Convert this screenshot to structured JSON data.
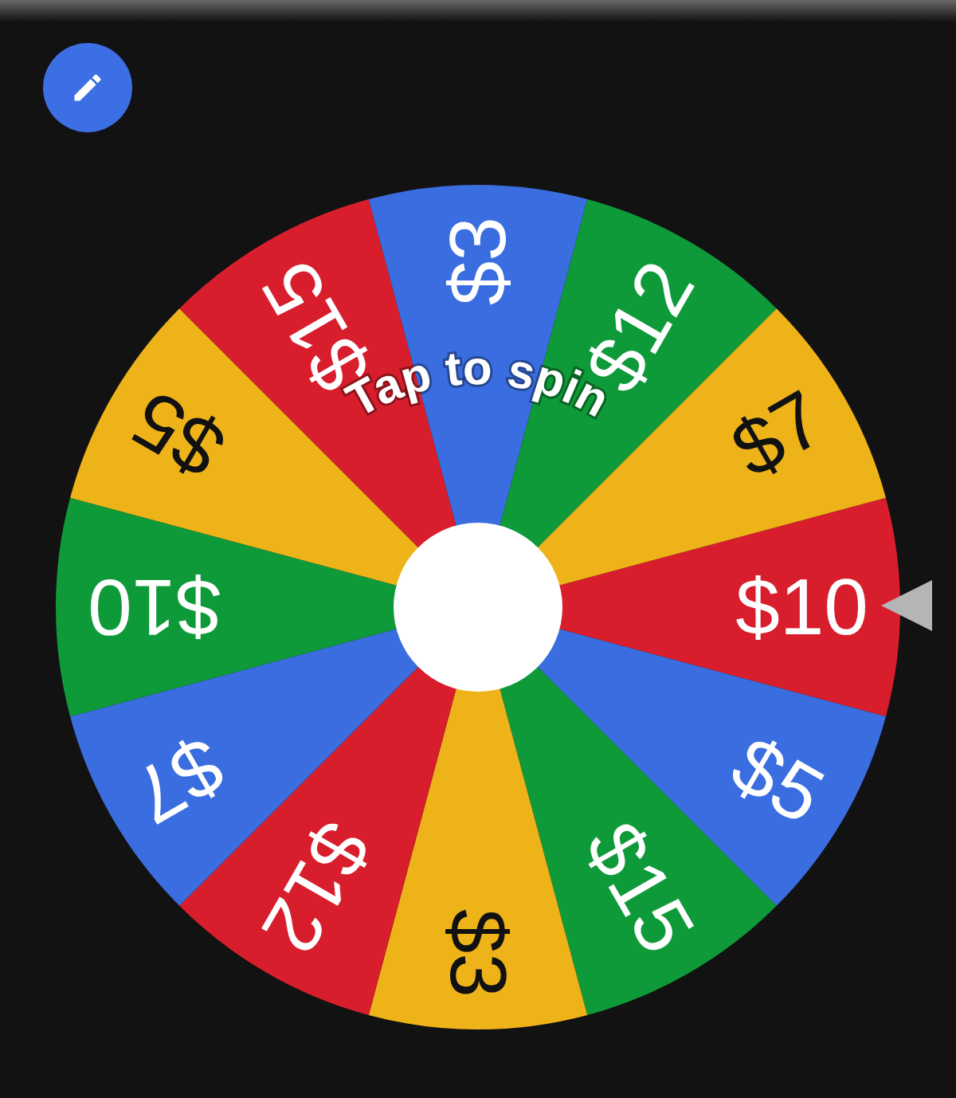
{
  "spin_hint": "Tap to spin",
  "segments": [
    {
      "label": "$10",
      "color": "#d81e2c"
    },
    {
      "label": "$5",
      "color": "#3a6ee0"
    },
    {
      "label": "$15",
      "color": "#0f9a3a"
    },
    {
      "label": "$3",
      "color": "#efb31a"
    },
    {
      "label": "$12",
      "color": "#d81e2c"
    },
    {
      "label": "$7",
      "color": "#3a6ee0"
    },
    {
      "label": "$10",
      "color": "#0f9a3a"
    },
    {
      "label": "$5",
      "color": "#efb31a"
    },
    {
      "label": "$15",
      "color": "#d81e2c"
    },
    {
      "label": "$3",
      "color": "#3a6ee0"
    },
    {
      "label": "$12",
      "color": "#0f9a3a"
    },
    {
      "label": "$7",
      "color": "#efb31a"
    }
  ]
}
